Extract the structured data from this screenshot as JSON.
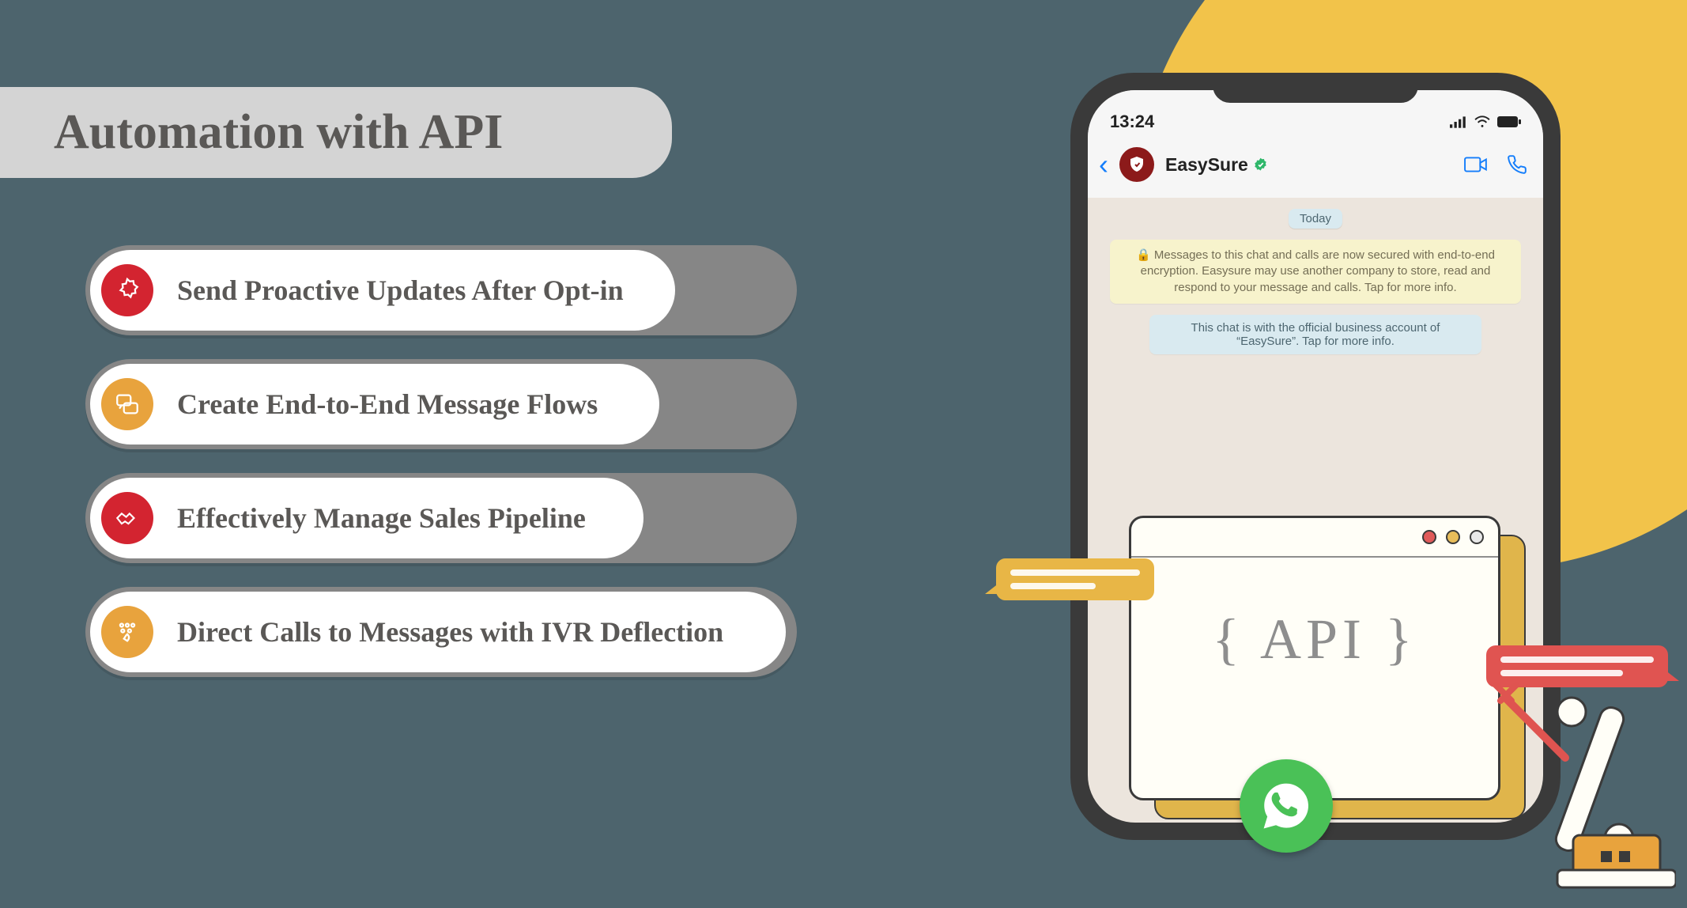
{
  "title": "Automation with API",
  "bullets": [
    {
      "label": "Send Proactive Updates After Opt-in",
      "color": "red",
      "icon": "badge"
    },
    {
      "label": "Create End-to-End Message Flows",
      "color": "orange",
      "icon": "flow"
    },
    {
      "label": "Effectively Manage Sales Pipeline",
      "color": "red",
      "icon": "handshake"
    },
    {
      "label": "Direct Calls to Messages with IVR Deflection",
      "color": "orange",
      "icon": "dial"
    }
  ],
  "phone": {
    "time": "13:24",
    "contact": "EasySure",
    "day_label": "Today",
    "encryption_notice": "Messages to this chat and calls are now secured with end-to-end encryption. Easysure may use another company to store, read and respond to your message and calls. Tap for more info.",
    "business_notice": "This chat is with the official business account of “EasySure”. Tap for more info.",
    "api_label": "{ API }"
  }
}
